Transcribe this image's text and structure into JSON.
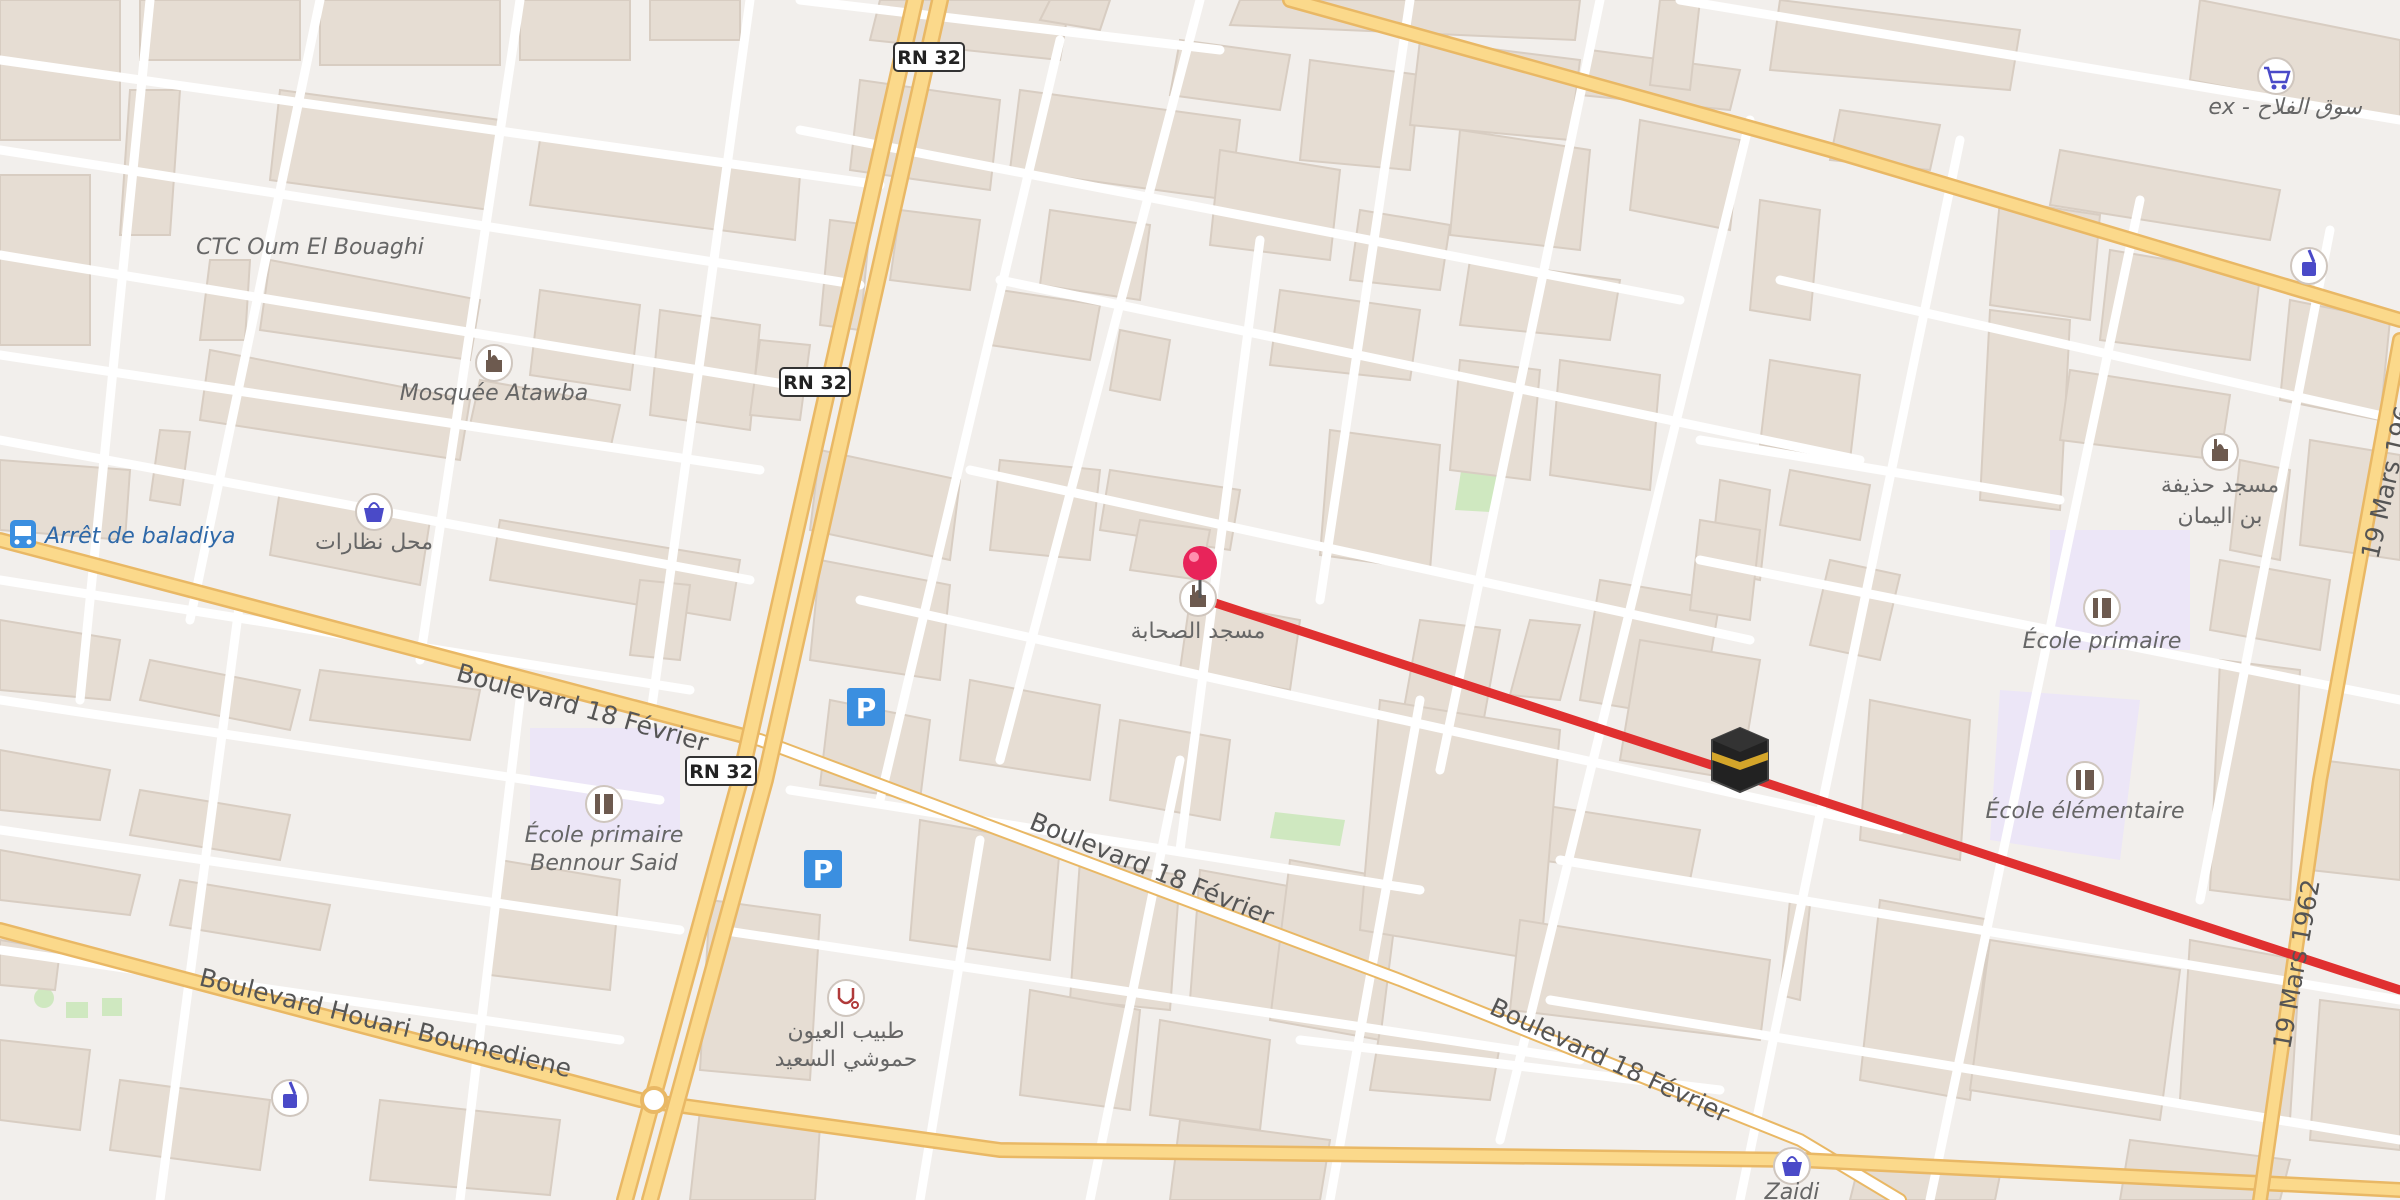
{
  "map": {
    "colors": {
      "background": "#f2efec",
      "building": "#e6ddd3",
      "building_stroke": "#d8cdc2",
      "minor_road": "#ffffff",
      "major_road": "#fbd98b",
      "major_road_casing": "#e9b865",
      "school_area": "#ece6f7",
      "park": "#cfe8c0",
      "qibla_line": "#e03030",
      "pin": "#e8245a",
      "parking": "#3b8fe0",
      "poi_icon": "#6d5a4f",
      "shop_icon": "#4a4ac8",
      "bus_icon": "#3b8fe0",
      "medical_icon": "#b03a3a"
    },
    "road_shields": [
      {
        "text": "RN 32"
      },
      {
        "text": "RN 32"
      },
      {
        "text": "RN 32"
      }
    ],
    "street_labels": {
      "bd18_west": "Boulevard 18 Février",
      "bd18_mid": "Boulevard 18 Février",
      "bd18_east": "Boulevard 18 Février",
      "houari": "Boulevard Houari Boumediene",
      "mars_top": "19 Mars 196",
      "mars_bottom": "19 Mars 1962"
    },
    "pois": {
      "ctc": "CTC Oum El Bouaghi",
      "mosquee_atawba": "Mosquée Atawba",
      "bus_stop": "Arrêt de baladiya",
      "optician": "محل نظارات",
      "mosque_sahaba": "مسجد الصحابة",
      "market": "ex - سوق الفلاح",
      "mosque_hudhayfa_1": "مسجد حذيفة",
      "mosque_hudhayfa_2": "بن اليمان",
      "ecole_primaire": "École primaire",
      "ecole_elementaire": "École élémentaire",
      "ecole_bennour_1": "École primaire",
      "ecole_bennour_2": "Bennour Said",
      "doctor_1": "طبيب العيون",
      "doctor_2": "حموشي السعيد",
      "zaidi": "Zaidi"
    },
    "icons": {
      "parking": "P"
    }
  }
}
